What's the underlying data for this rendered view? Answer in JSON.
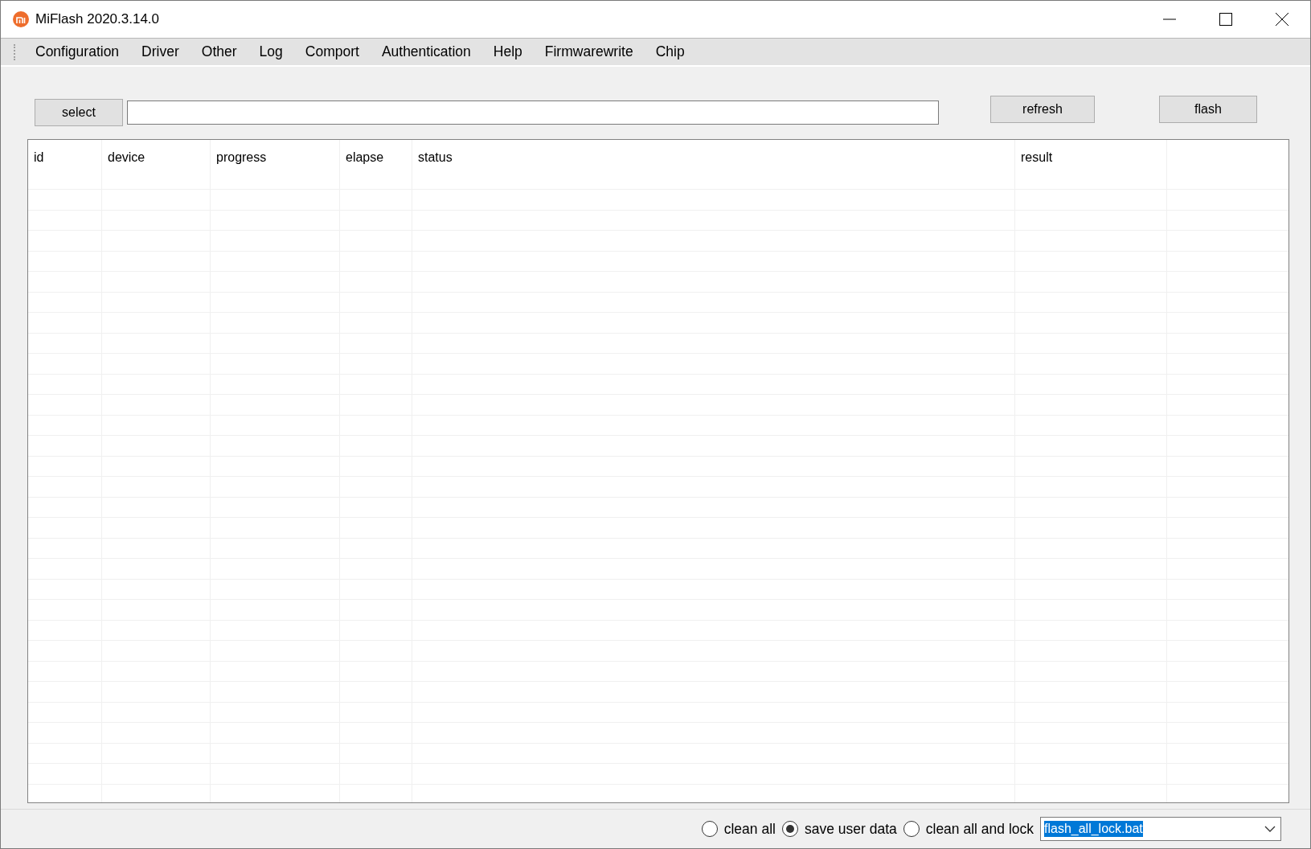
{
  "window": {
    "title": "MiFlash 2020.3.14.0"
  },
  "menu": [
    "Configuration",
    "Driver",
    "Other",
    "Log",
    "Comport",
    "Authentication",
    "Help",
    "Firmwarewrite",
    "Chip"
  ],
  "toolbar": {
    "select_button": "select",
    "refresh_button": "refresh",
    "flash_button": "flash"
  },
  "table": {
    "columns": [
      "id",
      "device",
      "progress",
      "elapse",
      "status",
      "result"
    ]
  },
  "options": [
    {
      "label": "clean all",
      "selected": false
    },
    {
      "label": "save user data",
      "selected": true
    },
    {
      "label": "clean all and lock",
      "selected": false
    }
  ],
  "script_select": {
    "value": "flash_all_lock.bat"
  }
}
